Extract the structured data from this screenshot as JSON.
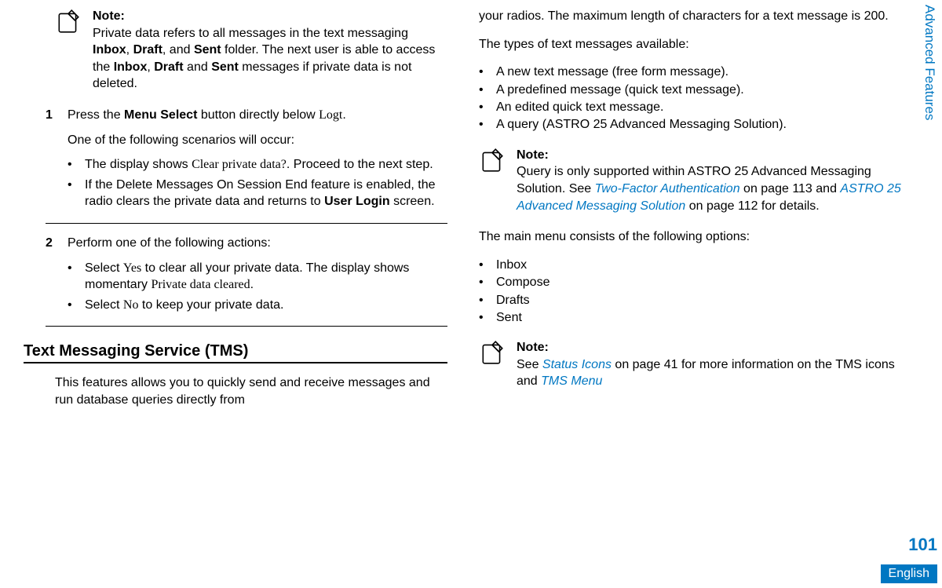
{
  "sidebar_label": "Advanced Features",
  "page_number": "101",
  "language": "English",
  "left": {
    "note1": {
      "title": "Note:",
      "text_parts": [
        "Private data refers to all messages in the text messaging ",
        "Inbox",
        ", ",
        "Draft",
        ", and ",
        "Sent",
        " folder. The next user is able to access the ",
        "Inbox",
        ", ",
        "Draft",
        " and ",
        "Sent",
        " messages if private data is not deleted."
      ]
    },
    "step1": {
      "num": "1",
      "line1_parts": [
        "Press the ",
        "Menu Select",
        " button directly below ",
        "Logt",
        "."
      ],
      "line2": "One of the following scenarios will occur:",
      "bullets": [
        {
          "parts": [
            "The display shows ",
            "Clear private data?",
            ". Proceed to the next step."
          ]
        },
        {
          "parts": [
            "If the Delete Messages On Session End feature is enabled, the radio clears the private data and returns to ",
            "User Login",
            " screen."
          ]
        }
      ]
    },
    "step2": {
      "num": "2",
      "line1": "Perform one of the following actions:",
      "bullets": [
        {
          "parts": [
            "Select ",
            "Yes",
            " to clear all your private data. The display shows momentary ",
            "Private data cleared",
            "."
          ]
        },
        {
          "parts": [
            "Select ",
            "No",
            " to keep your private data."
          ]
        }
      ]
    },
    "section_title": "Text Messaging Service (TMS)",
    "section_body": "This features allows you to quickly send and receive messages and run database queries directly from"
  },
  "right": {
    "top_para": "your radios. The maximum length of characters for a text message is 200.",
    "types_intro": "The types of text messages available:",
    "types": [
      "A new text message (free form message).",
      "A predefined message (quick text message).",
      "An edited quick text message.",
      "A query (ASTRO 25 Advanced Messaging Solution)."
    ],
    "note2": {
      "title": "Note:",
      "pre": "Query is only supported within ASTRO 25 Advanced Messaging Solution. See ",
      "link1": "Two-Factor Authentication",
      "mid1": " on page 113 and ",
      "link2": "ASTRO 25 Advanced Messaging Solution",
      "mid2": " on page 112 for details."
    },
    "menu_intro": "The main menu consists of the following options:",
    "menu": [
      "Inbox",
      "Compose",
      "Drafts",
      "Sent"
    ],
    "note3": {
      "title": "Note:",
      "pre": "See ",
      "link1": "Status Icons",
      "mid1": " on page 41 for more information on the TMS icons and ",
      "link2": "TMS Menu"
    }
  }
}
